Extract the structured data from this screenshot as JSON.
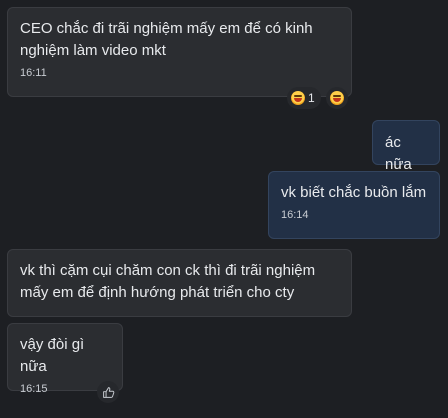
{
  "messages": [
    {
      "text": "CEO chắc đi trãi nghiệm mấy em để có kinh nghiệm làm video mkt",
      "time": "16:11",
      "reactions": [
        {
          "icon": "laughing-emoji",
          "count": "1"
        },
        {
          "icon": "laughing-emoji"
        }
      ]
    },
    {
      "text": "ác nữa"
    },
    {
      "text": "vk biết chắc buồn lắm",
      "time": "16:14"
    },
    {
      "text": "vk thì cặm cụi chăm con ck thì đi trãi nghiệm mấy em để định hướng phát triển cho cty"
    },
    {
      "text": "vậy đòi gì nữa",
      "time": "16:15",
      "action_icon": "thumbs-up-icon"
    }
  ],
  "colors": {
    "background": "#1d1f23",
    "incoming": "#2b2d31",
    "outgoing": "#223046"
  }
}
